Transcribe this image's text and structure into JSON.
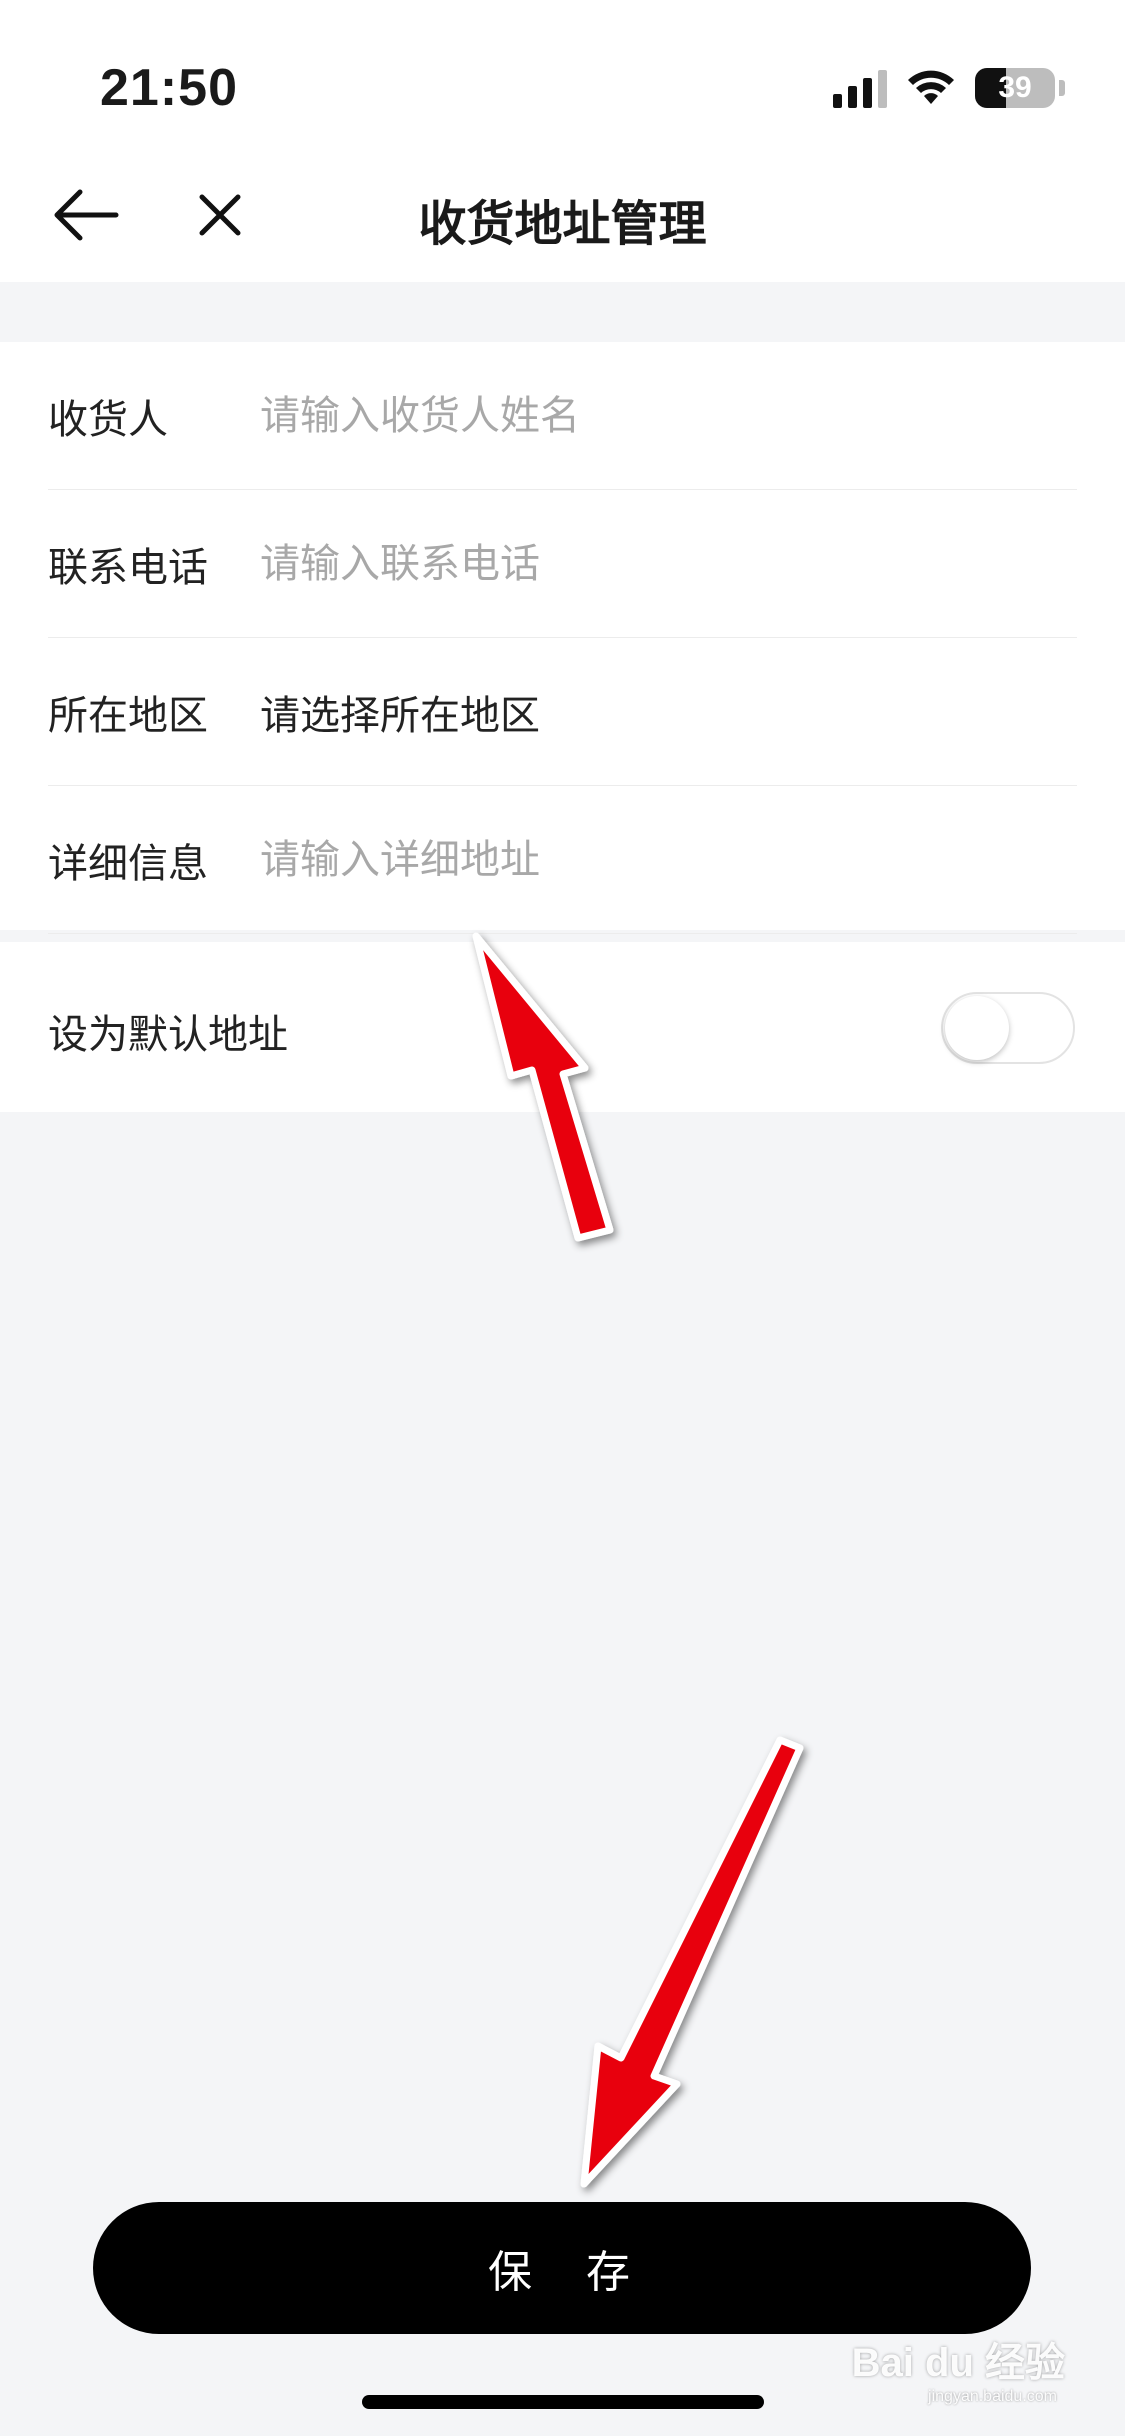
{
  "status_bar": {
    "time": "21:50",
    "battery_level": "39",
    "icons": [
      "signal-icon",
      "wifi-icon",
      "battery-icon"
    ]
  },
  "nav": {
    "title": "收货地址管理",
    "back_icon": "arrow-left-icon",
    "close_icon": "close-icon"
  },
  "form": {
    "rows": [
      {
        "label": "收货人",
        "placeholder": "请输入收货人姓名",
        "value": ""
      },
      {
        "label": "联系电话",
        "placeholder": "请输入联系电话",
        "value": ""
      },
      {
        "label": "所在地区",
        "value": "请选择所在地区"
      },
      {
        "label": "详细信息",
        "placeholder": "请输入详细地址",
        "value": ""
      }
    ]
  },
  "default_address": {
    "label": "设为默认地址",
    "enabled": false
  },
  "save_button": {
    "label": "保 存"
  },
  "watermark": {
    "brand": "Bai du 经验",
    "site": "jingyan.baidu.com"
  },
  "annotations": {
    "arrow_color": "#e8000b"
  }
}
